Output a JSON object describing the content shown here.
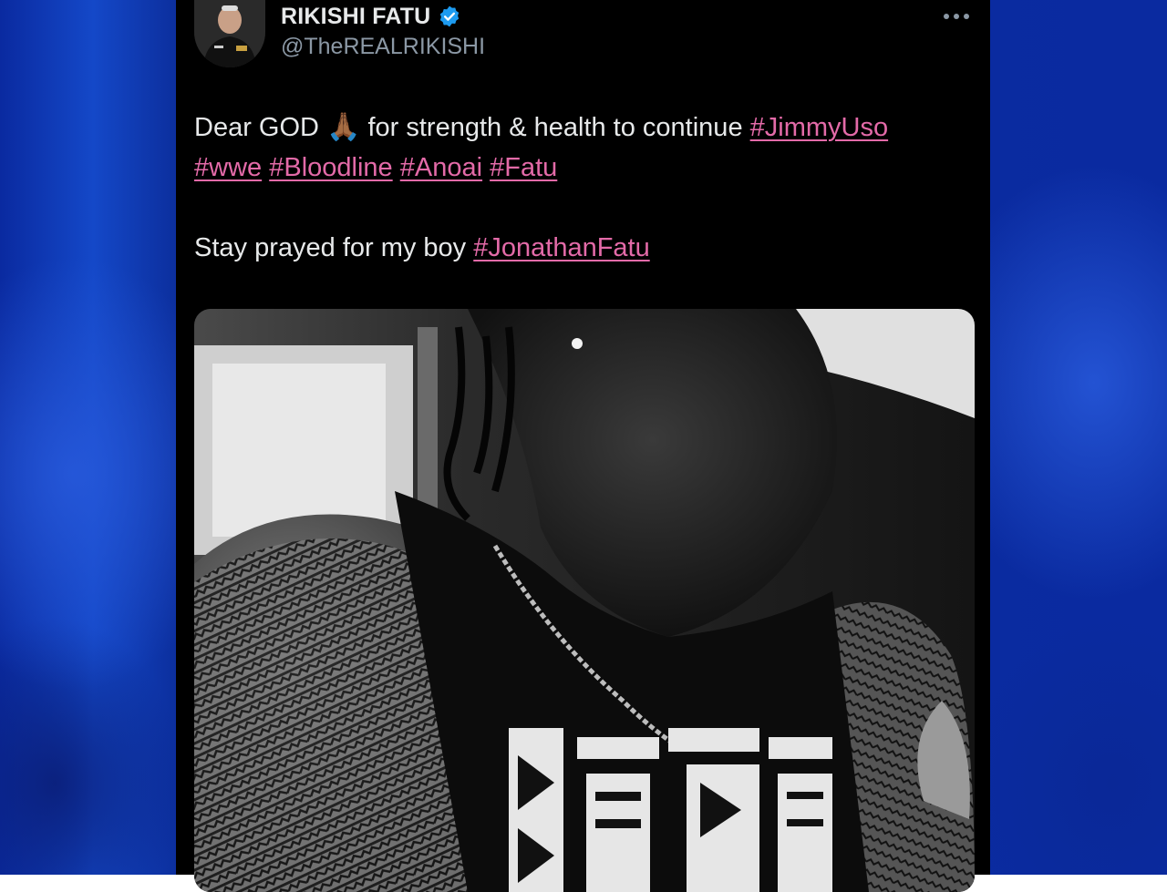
{
  "post": {
    "author": {
      "display_name": "RIKISHI FATU",
      "handle": "@TheREALRIKISHI",
      "verified": true,
      "avatar_icon": "profile-photo"
    },
    "more_icon": "ellipsis-icon",
    "text": {
      "line1": {
        "prefix": "Dear GOD",
        "emoji": "🙏🏾",
        "suffix": "for strength & health to continue",
        "hashtag": "#JimmyUso"
      },
      "line2": {
        "hashtags": [
          "#wwe",
          "#Bloodline",
          "#Anoai",
          "#Fatu"
        ]
      },
      "line3": {
        "prefix": "Stay prayed for my boy",
        "hashtag": "#JonathanFatu"
      }
    },
    "media": {
      "type": "photo",
      "style": "black-and-white"
    }
  },
  "colors": {
    "card_background": "#000000",
    "text": "#e7e9ea",
    "secondary_text": "#8b98a5",
    "hashtag": "#e36aa8",
    "verified_badge": "#1d9bf0",
    "backdrop": "#1448c8"
  }
}
